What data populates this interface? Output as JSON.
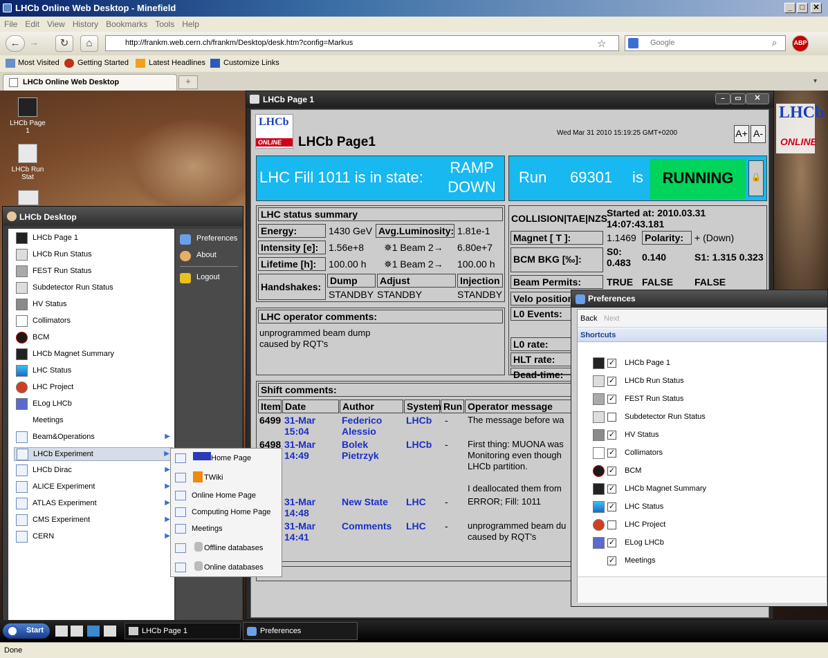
{
  "browser": {
    "title": "LHCb Online Web Desktop - Minefield",
    "menu": [
      "File",
      "Edit",
      "View",
      "History",
      "Bookmarks",
      "Tools",
      "Help"
    ],
    "url": "http://frankm.web.cern.ch/frankm/Desktop/desk.htm?config=Markus",
    "search_placeholder": "Google",
    "bookmarks": [
      "Most Visited",
      "Getting Started",
      "Latest Headlines",
      "Customize Links"
    ],
    "tab": "LHCb Online Web Desktop",
    "status": "Done"
  },
  "desktop_icons": [
    "LHCb Page 1",
    "LHCb Run Stat"
  ],
  "page1": {
    "window_title": "LHCb Page 1",
    "logo": {
      "line1": "LHCb",
      "line2": "ONLINE"
    },
    "title": "LHCb Page1",
    "timestamp": "Wed Mar 31 2010 15:19:25 GMT+0200",
    "font_up": "A+",
    "font_down": "A-",
    "fill_text": "LHC Fill 1011 is in state:",
    "fill_state_l1": "RAMP",
    "fill_state_l2": "DOWN",
    "run_label": "Run",
    "run_number": "69301",
    "run_is": "is",
    "run_state": "RUNNING",
    "status": {
      "header": "LHC status summary",
      "energy_label": "Energy:",
      "energy": "1430 GeV",
      "lumi_label": "Avg.Luminosity:",
      "lumi": "1.81e-1",
      "intensity_label": "Intensity [e]:",
      "intensity_b1": "1.56e+8",
      "beam_label": "✵1 Beam 2→",
      "intensity_b2": "6.80e+7",
      "lifetime_label": "Lifetime [h]:",
      "lifetime_b1": "100.00 h",
      "lifetime_beam_label": "✵1 Beam 2→",
      "lifetime_b2": "100.00 h",
      "handshakes_label": "Handshakes:",
      "dump_label": "Dump",
      "adjust_label": "Adjust",
      "injection_label": "Injection",
      "dump": "STANDBY",
      "adjust": "STANDBY",
      "injection": "STANDBY"
    },
    "operator": {
      "header": "LHC operator comments:",
      "line1": "unprogrammed beam dump",
      "line2": "caused by RQT's"
    },
    "run_info": {
      "mode": "COLLISION|TAE|NZS",
      "started_l1": "Started at: 2010.03.31",
      "started_l2": "14:07:43.181",
      "magnet_label": "Magnet [ T ]:",
      "magnet": "1.1469",
      "polarity_label": "Polarity:",
      "polarity": "+ (Down)",
      "bcm_label": "BCM BKG [‰]:",
      "s0_label": "S0:",
      "s0": "0.483",
      "bcm_mid": "0.140",
      "s1": "S1: 1.315 0.323",
      "permits_label": "Beam Permits:",
      "permit1": "TRUE",
      "permit2": "FALSE",
      "permit3": "FALSE",
      "velo_label": "Velo position",
      "l0events_label": "L0 Events:",
      "l0rate_label": "L0 rate:",
      "hltrate_label": "HLT rate:",
      "deadtime_label": "Dead-time:"
    },
    "shift": {
      "header": "Shift comments:",
      "columns": [
        "Item",
        "Date",
        "Author",
        "System",
        "Run",
        "Operator message"
      ],
      "rows": [
        {
          "item": "6499",
          "date1": "31-Mar",
          "date2": "15:04",
          "author1": "Federico",
          "author2": "Alessio",
          "system": "LHCb",
          "run": "-",
          "msg": [
            "The message before wa"
          ]
        },
        {
          "item": "6498",
          "date1": "31-Mar",
          "date2": "14:49",
          "author1": "Bolek",
          "author2": "Pietrzyk",
          "system": "LHCb",
          "run": "-",
          "msg": [
            "First thing: MUONA was",
            "Monitoring even though",
            "LHCb partition.",
            "",
            "I deallocated them from"
          ]
        },
        {
          "item": "",
          "date1": "31-Mar",
          "date2": "14:48",
          "author1": "New State",
          "author2": "",
          "system": "LHC",
          "run": "-",
          "msg": [
            "ERROR; Fill: 1011"
          ]
        },
        {
          "item": "",
          "date1": "31-Mar",
          "date2": "14:41",
          "author1": "Comments",
          "author2": "",
          "system": "LHC",
          "run": "-",
          "msg": [
            "unprogrammed beam du",
            "caused by RQT's"
          ]
        }
      ]
    }
  },
  "desktop_window": {
    "title": "LHCb Desktop",
    "items": [
      {
        "label": "LHCb Page 1",
        "icon": "binoculars-icon"
      },
      {
        "label": "LHCb Run Status",
        "icon": "run-status-icon"
      },
      {
        "label": "FEST Run Status",
        "icon": "fest-icon"
      },
      {
        "label": "Subdetector Run Status",
        "icon": "subdetector-icon"
      },
      {
        "label": "HV Status",
        "icon": "hv-icon"
      },
      {
        "label": "Collimators",
        "icon": "collimators-icon"
      },
      {
        "label": "BCM",
        "icon": "bcm-icon"
      },
      {
        "label": "LHCb Magnet Summary",
        "icon": "magnet-icon"
      },
      {
        "label": "LHC Status",
        "icon": "lhc-status-icon"
      },
      {
        "label": "LHC Project",
        "icon": "lhc-project-icon"
      },
      {
        "label": "ELog LHCb",
        "icon": "elog-icon"
      },
      {
        "label": "Meetings",
        "icon": "meetings-icon"
      },
      {
        "label": "Beam&Operations",
        "icon": "window-icon"
      },
      {
        "label": "LHCb Experiment",
        "icon": "window-icon"
      },
      {
        "label": "LHCb Dirac",
        "icon": "window-icon"
      },
      {
        "label": "ALICE Experiment",
        "icon": "window-icon"
      },
      {
        "label": "ATLAS Experiment",
        "icon": "window-icon"
      },
      {
        "label": "CMS Experiment",
        "icon": "window-icon"
      },
      {
        "label": "CERN",
        "icon": "window-icon"
      }
    ],
    "right": [
      "Preferences",
      "About",
      "Logout"
    ]
  },
  "submenu": [
    "Home Page",
    "TWiki",
    "Online Home Page",
    "Computing Home Page",
    "Meetings",
    "Offline databases",
    "Online databases"
  ],
  "preferences": {
    "title": "Preferences",
    "back": "Back",
    "next": "Next",
    "section": "Shortcuts",
    "items": [
      {
        "label": "LHCb Page 1",
        "checked": true
      },
      {
        "label": "LHCb Run Status",
        "checked": true
      },
      {
        "label": "FEST Run Status",
        "checked": true
      },
      {
        "label": "Subdetector Run Status",
        "checked": false
      },
      {
        "label": "HV Status",
        "checked": true
      },
      {
        "label": "Collimators",
        "checked": true
      },
      {
        "label": "BCM",
        "checked": true
      },
      {
        "label": "LHCb Magnet Summary",
        "checked": true
      },
      {
        "label": "LHC Status",
        "checked": true
      },
      {
        "label": "LHC Project",
        "checked": false
      },
      {
        "label": "ELog LHCb",
        "checked": true
      },
      {
        "label": "Meetings",
        "checked": true
      }
    ]
  },
  "taskbar": {
    "start": "Start",
    "task1": "LHCb Page 1",
    "task2": "Preferences"
  }
}
